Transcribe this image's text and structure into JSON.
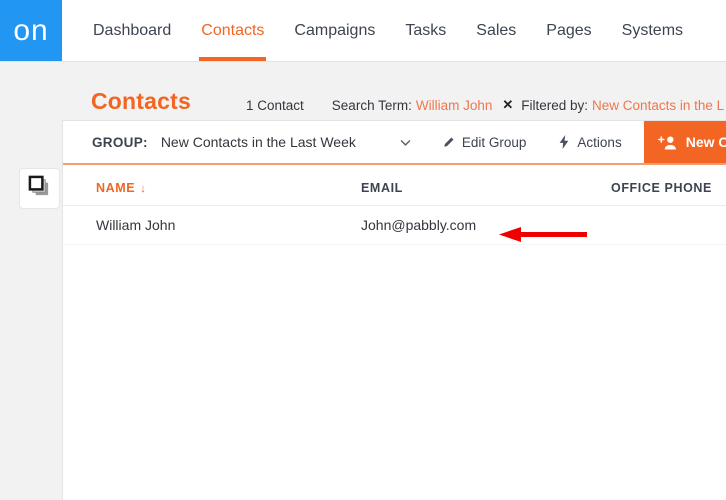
{
  "nav": {
    "logo_text": "on",
    "logo_color": "#2196f3",
    "accent_color": "#f26522",
    "tabs": [
      {
        "label": "Dashboard",
        "active": false
      },
      {
        "label": "Contacts",
        "active": true
      },
      {
        "label": "Campaigns",
        "active": false
      },
      {
        "label": "Tasks",
        "active": false
      },
      {
        "label": "Sales",
        "active": false
      },
      {
        "label": "Pages",
        "active": false
      },
      {
        "label": "Systems",
        "active": false
      }
    ]
  },
  "page": {
    "title": "Contacts",
    "record_count": "1 Contact",
    "search_term_label": "Search Term:",
    "search_term_value": "William John",
    "clear_search_glyph": "✕",
    "filtered_by_label": "Filtered by:",
    "filtered_by_value": "New Contacts in the L"
  },
  "toolbar": {
    "group_label": "GROUP:",
    "group_value": "New Contacts in the Last Week",
    "edit_group_label": "Edit Group",
    "actions_label": "Actions",
    "new_contact_label": "New Co",
    "icons": {
      "dropdown": "chevron-down-icon",
      "edit": "pencil-icon",
      "actions": "lightning-bolt-icon",
      "new_contact": "add-user-icon"
    }
  },
  "table": {
    "columns": [
      {
        "label": "NAME",
        "sorted": true,
        "sort_glyph": "↓"
      },
      {
        "label": "EMAIL",
        "sorted": false,
        "sort_glyph": ""
      },
      {
        "label": "OFFICE PHONE",
        "sorted": false,
        "sort_glyph": ""
      }
    ],
    "rows": [
      {
        "name": "William John",
        "email": "John@pabbly.com",
        "office_phone": ""
      }
    ]
  },
  "sidebar": {
    "layers_icon_name": "layers-icon"
  },
  "annotation": {
    "arrow_color": "#ee0000",
    "arrow_direction": "left"
  }
}
